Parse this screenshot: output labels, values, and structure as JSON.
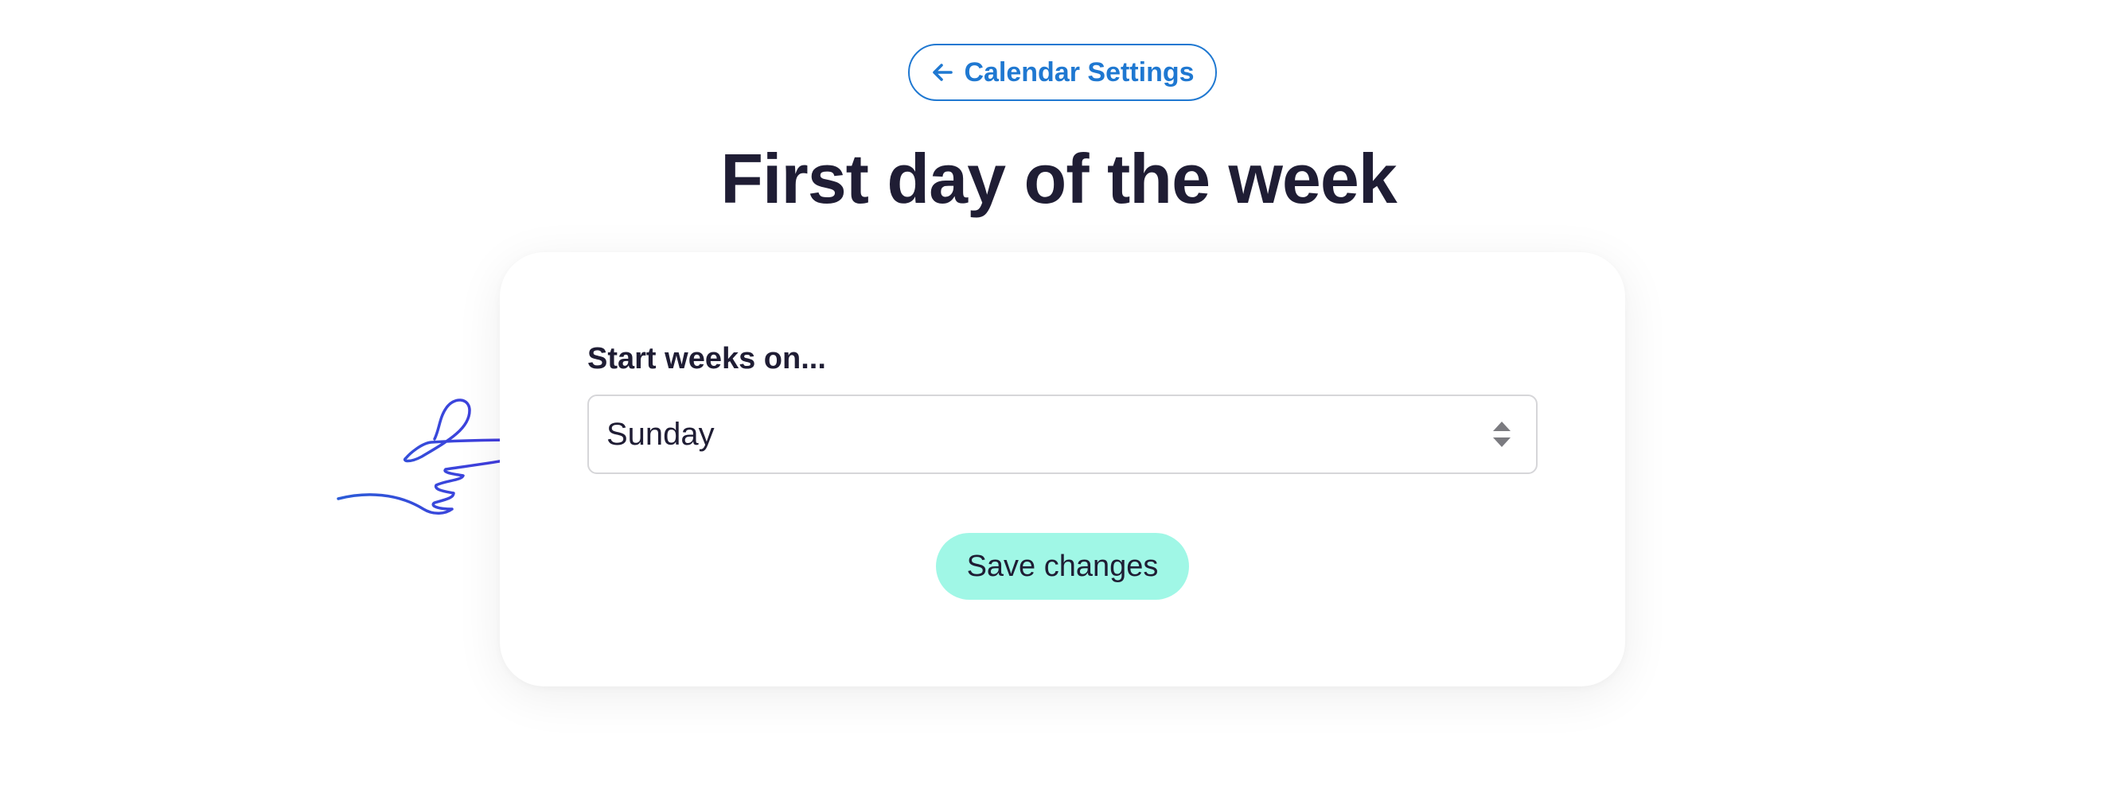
{
  "header": {
    "back_label": "Calendar Settings",
    "back_icon": "arrow-left-icon"
  },
  "page": {
    "title": "First day of the week"
  },
  "form": {
    "field_label": "Start weeks on...",
    "select_value": "Sunday",
    "select_icon": "up-down-arrows-icon",
    "save_label": "Save changes"
  },
  "decoration": {
    "pointer_icon": "pointing-hand-icon"
  },
  "colors": {
    "link": "#1f78d1",
    "text": "#1f1d34",
    "button_bg": "#a0f7e6",
    "hand_stroke": "#3b4fe0"
  }
}
